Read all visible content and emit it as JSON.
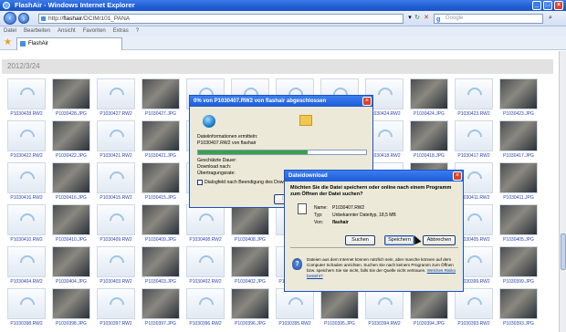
{
  "window": {
    "title": "FlashAir - Windows Internet Explorer"
  },
  "address": {
    "prefix": "http://",
    "host": "flashair",
    "path": "/DCIM/101_PANA",
    "search_placeholder": "Google"
  },
  "menu": [
    "Datei",
    "Bearbeiten",
    "Ansicht",
    "Favoriten",
    "Extras",
    "?"
  ],
  "tab": {
    "label": "FlashAir"
  },
  "gallery": {
    "date": "2012/3/24",
    "rows": [
      [
        {
          "name": "P1030428.RW2",
          "photo": false
        },
        {
          "name": "P1030428.JPG",
          "photo": true
        },
        {
          "name": "P1030427.RW2",
          "photo": false
        },
        {
          "name": "P1030427.JPG",
          "photo": true
        },
        {
          "name": "",
          "photo": false
        },
        {
          "name": "",
          "photo": false
        },
        {
          "name": "",
          "photo": false
        },
        {
          "name": "",
          "photo": false
        },
        {
          "name": "P1030424.RW2",
          "photo": false
        },
        {
          "name": "P1030424.JPG",
          "photo": true
        },
        {
          "name": "P1030423.RW2",
          "photo": false
        },
        {
          "name": "P1030423.JPG",
          "photo": true
        }
      ],
      [
        {
          "name": "P1030422.RW2",
          "photo": false
        },
        {
          "name": "P1030422.JPG",
          "photo": true
        },
        {
          "name": "P1030421.RW2",
          "photo": false
        },
        {
          "name": "P1030421.JPG",
          "photo": true
        },
        {
          "name": "",
          "photo": false
        },
        {
          "name": "",
          "photo": false
        },
        {
          "name": "",
          "photo": false
        },
        {
          "name": "",
          "photo": false
        },
        {
          "name": "P1030418.RW2",
          "photo": false
        },
        {
          "name": "P1030418.JPG",
          "photo": true
        },
        {
          "name": "P1030417.RW2",
          "photo": false
        },
        {
          "name": "P1030417.JPG",
          "photo": true
        }
      ],
      [
        {
          "name": "P1030416.RW2",
          "photo": false
        },
        {
          "name": "P1030416.JPG",
          "photo": true
        },
        {
          "name": "P1030415.RW2",
          "photo": false
        },
        {
          "name": "P1030415.JPG",
          "photo": true
        },
        {
          "name": "",
          "photo": false
        },
        {
          "name": "",
          "photo": false
        },
        {
          "name": "",
          "photo": false
        },
        {
          "name": "",
          "photo": false
        },
        {
          "name": "",
          "photo": false
        },
        {
          "name": "",
          "photo": true
        },
        {
          "name": "P1030411.RW2",
          "photo": false
        },
        {
          "name": "P1030411.JPG",
          "photo": true
        }
      ],
      [
        {
          "name": "P1030410.RW2",
          "photo": false
        },
        {
          "name": "P1030410.JPG",
          "photo": true
        },
        {
          "name": "P1030409.RW2",
          "photo": false
        },
        {
          "name": "P1030409.JPG",
          "photo": true
        },
        {
          "name": "P1030408.RW2",
          "photo": false
        },
        {
          "name": "P1030408.JPG",
          "photo": true
        },
        {
          "name": "",
          "photo": false
        },
        {
          "name": "",
          "photo": false
        },
        {
          "name": "",
          "photo": false
        },
        {
          "name": "",
          "photo": true
        },
        {
          "name": "P1030405.RW2",
          "photo": false
        },
        {
          "name": "P1030405.JPG",
          "photo": true
        }
      ],
      [
        {
          "name": "P1030404.RW2",
          "photo": false
        },
        {
          "name": "P1030404.JPG",
          "photo": true
        },
        {
          "name": "P1030403.RW2",
          "photo": false
        },
        {
          "name": "P1030403.JPG",
          "photo": true
        },
        {
          "name": "P1030402.RW2",
          "photo": false
        },
        {
          "name": "P1030402.JPG",
          "photo": true
        },
        {
          "name": "P1030401.RW2",
          "photo": false
        },
        {
          "name": "",
          "photo": false
        },
        {
          "name": "",
          "photo": false
        },
        {
          "name": "",
          "photo": true
        },
        {
          "name": "P1030399.RW2",
          "photo": false
        },
        {
          "name": "P1030399.JPG",
          "photo": true
        }
      ],
      [
        {
          "name": "P1030398.RW2",
          "photo": false
        },
        {
          "name": "P1030398.JPG",
          "photo": true
        },
        {
          "name": "P1030397.RW2",
          "photo": false
        },
        {
          "name": "P1030397.JPG",
          "photo": true
        },
        {
          "name": "P1030396.RW2",
          "photo": false
        },
        {
          "name": "P1030396.JPG",
          "photo": true
        },
        {
          "name": "P1030395.RW2",
          "photo": false
        },
        {
          "name": "P1030395.JPG",
          "photo": true
        },
        {
          "name": "P1030394.RW2",
          "photo": false
        },
        {
          "name": "P1030394.JPG",
          "photo": true
        },
        {
          "name": "P1030393.RW2",
          "photo": false
        },
        {
          "name": "P1030393.JPG",
          "photo": true
        }
      ]
    ]
  },
  "progress_dialog": {
    "title": "0% von P1030407.RW2 von flashair abgeschlossen",
    "info_label": "Dateiinformationen ermitteln:",
    "info_value": "P1030407.RW2 von flashair",
    "progress": 0.65,
    "remaining": "Geschätzte Dauer:",
    "download_to": "Download nach:",
    "rate": "Übertragungsrate:",
    "checkbox": "Dialogfeld nach Beendigung des Downloads schließen",
    "open_button": "Öffnen"
  },
  "download_dialog": {
    "title": "Dateidownload",
    "question": "Möchten Sie die Datei speichern oder online nach einem Programm zum Öffnen der Datei suchen?",
    "name_label": "Name:",
    "name_value": "P1030407.RW2",
    "type_label": "Typ:",
    "type_value": "Unbekannter Dateityp, 18,5 MB",
    "from_label": "Von:",
    "from_value": "flashair",
    "btn_search": "Suchen",
    "btn_save": "Speichern",
    "btn_cancel": "Abbrechen",
    "warning": "Dateien aus dem Internet können nützlich sein, aber manche können auf dem Computer Schaden anrichten. Suchen Sie nach keinem Programm zum Öffnen bzw. speichern Sie sie nicht, falls Sie der Quelle nicht vertrauen.",
    "warning_link": "Welches Risiko besteht?"
  }
}
